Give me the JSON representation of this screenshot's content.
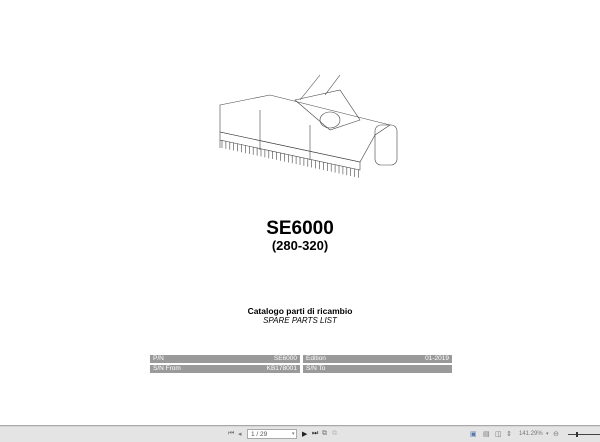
{
  "document": {
    "title": "SE6000",
    "subtitle": "(280-320)",
    "catalog_it": "Catalogo parti di ricambio",
    "catalog_en": "SPARE PARTS LIST",
    "info": {
      "pn_label": "P/N",
      "pn_value": "SE6000",
      "edition_label": "Edition",
      "edition_value": "01-2019",
      "sn_from_label": "S/N From",
      "sn_from_value": "KB178001",
      "sn_to_label": "S/N To",
      "sn_to_value": ""
    }
  },
  "toolbar": {
    "page_field": "1 / 29",
    "zoom_level": "141.29%"
  }
}
